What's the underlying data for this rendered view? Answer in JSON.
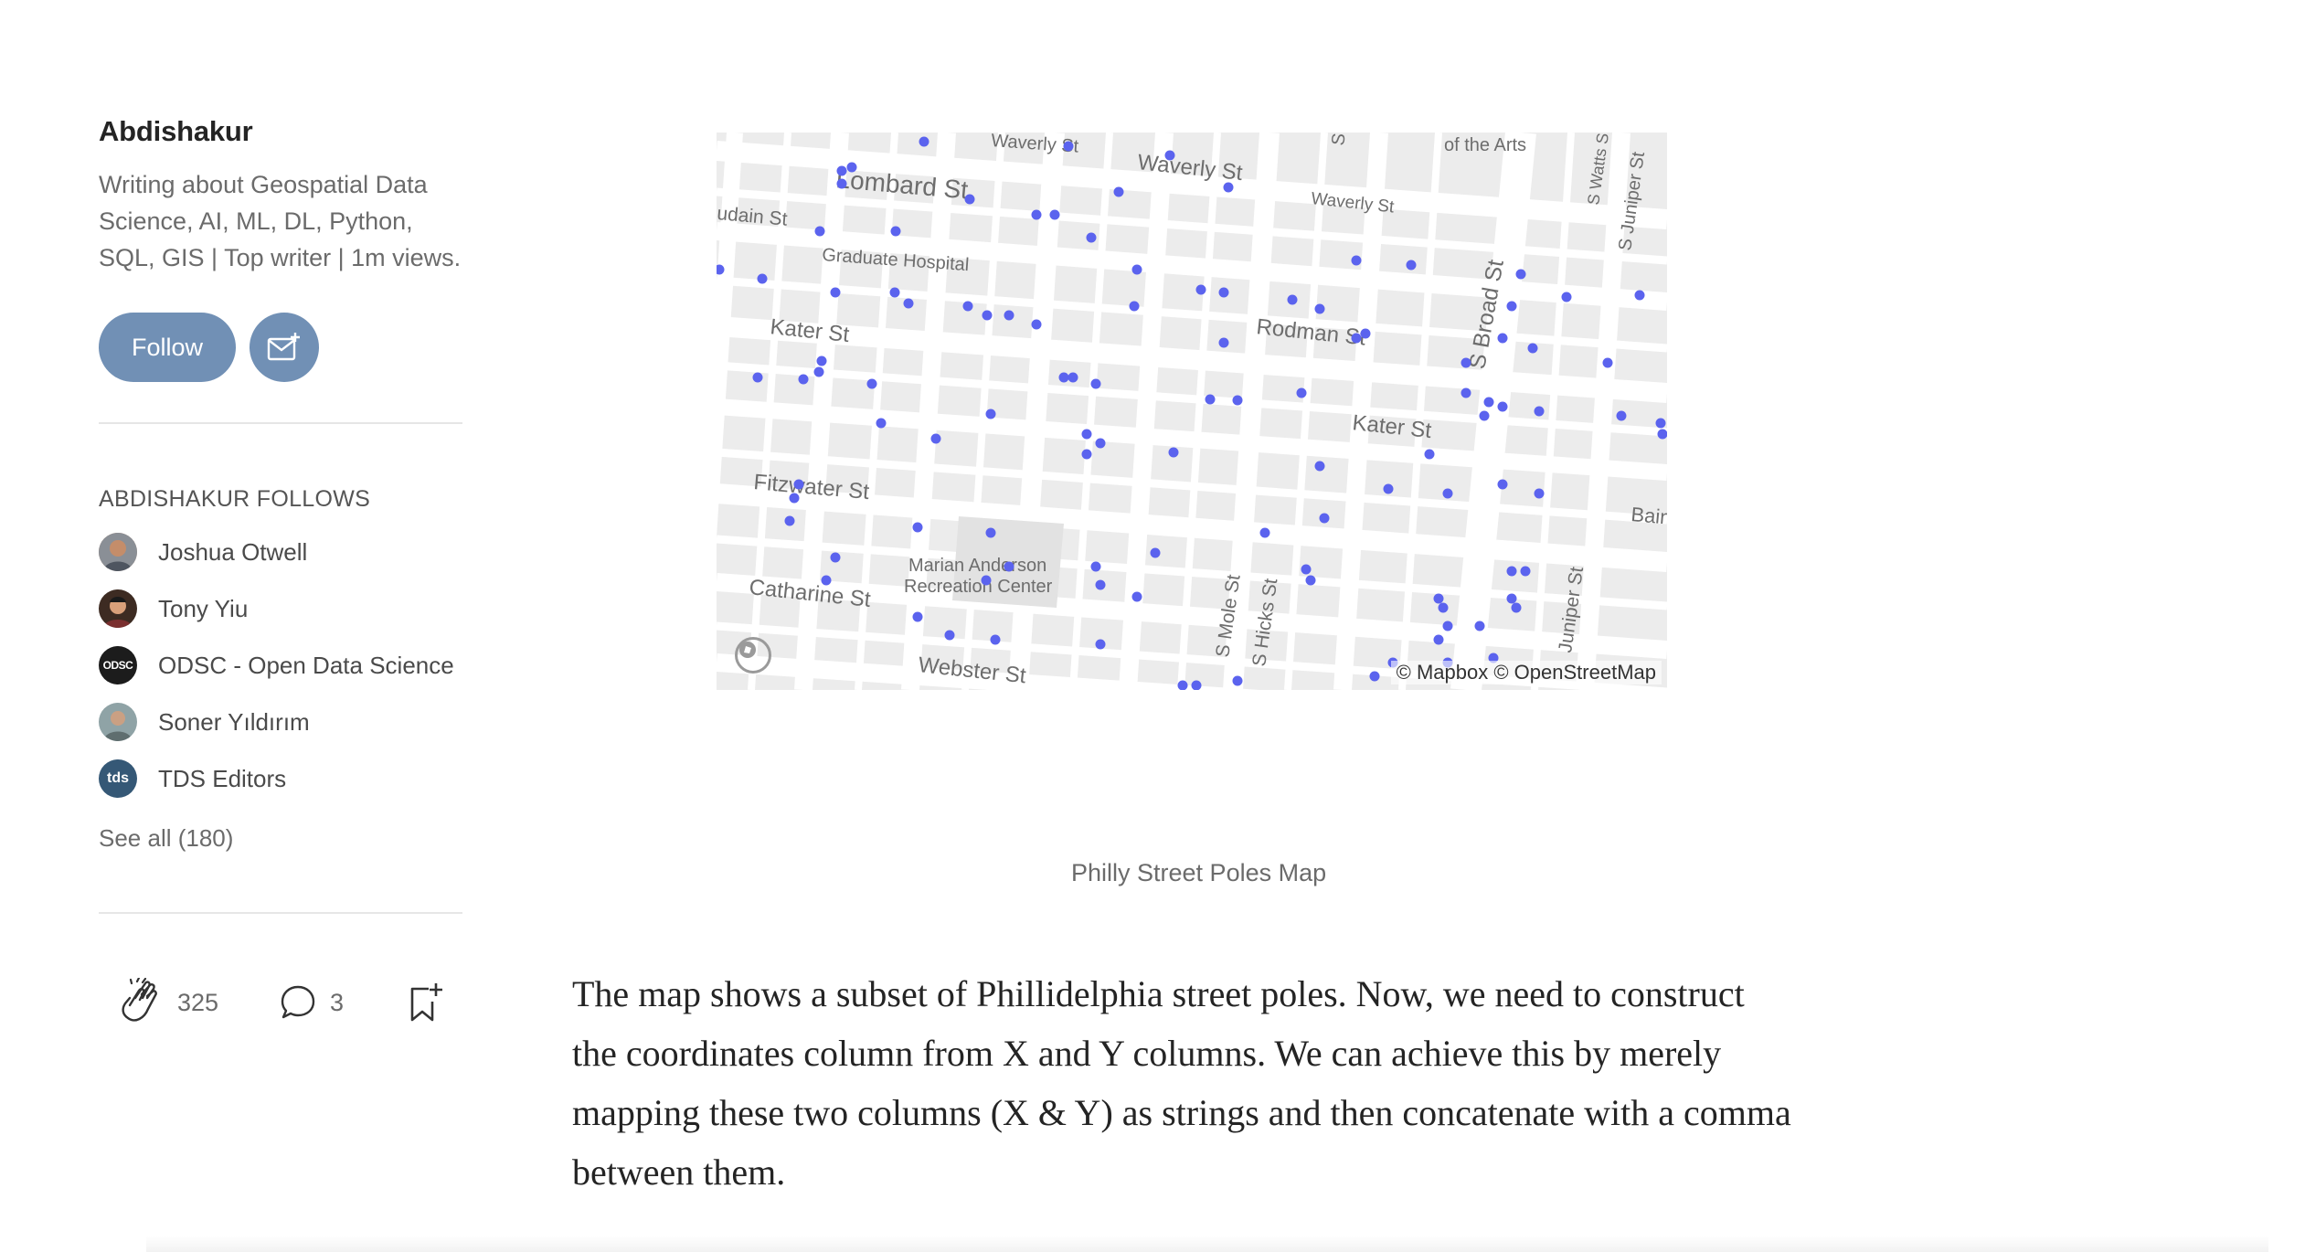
{
  "author": {
    "name": "Abdishakur",
    "bio": "Writing about Geospatial Data Science, AI, ML, DL, Python, SQL, GIS | Top writer | 1m views.",
    "follow_label": "Follow"
  },
  "follows": {
    "heading": "ABDISHAKUR FOLLOWS",
    "items": [
      {
        "name": "Joshua Otwell",
        "avatar": "photo"
      },
      {
        "name": "Tony Yiu",
        "avatar": "photo"
      },
      {
        "name": "ODSC - Open Data Science",
        "avatar": "ODSC"
      },
      {
        "name": "Soner Yıldırım",
        "avatar": "photo"
      },
      {
        "name": "TDS Editors",
        "avatar": "tds"
      }
    ],
    "see_all": "See all (180)"
  },
  "actions": {
    "claps": "325",
    "comments": "3"
  },
  "map": {
    "credit": "© Mapbox © OpenStreetMap",
    "point_color": "#5b63ee",
    "labels": {
      "waverly1": "Waverly St",
      "waverly2": "Waverly St",
      "waverly3": "Waverly St",
      "lombard": "Lombard St",
      "aidain": "udain St",
      "graduate": "Graduate Hospital",
      "kater1": "Kater St",
      "kater2": "Kater St",
      "rodman": "Rodman St",
      "sbroad": "S Broad St",
      "fitzwater": "Fitzwater St",
      "catharine": "Catharine St",
      "marian1": "Marian Anderson",
      "marian2": "Recreation Center",
      "webster": "Webster St",
      "smole": "S Mole St",
      "shicks": "S Hicks St",
      "juniper1": "Juniper St",
      "swatts": "S Watts St",
      "sjuniper": "S Juniper St",
      "arts": "of the Arts",
      "bain": "Bain",
      "s": "S"
    }
  },
  "caption": "Philly Street Poles Map",
  "paragraph": "The map shows a subset of Phillidelphia street poles. Now, we need to construct the coordinates column from X and Y columns. We can achieve this by merely mapping these two columns (X & Y) as strings and then concatenate with a comma between them."
}
